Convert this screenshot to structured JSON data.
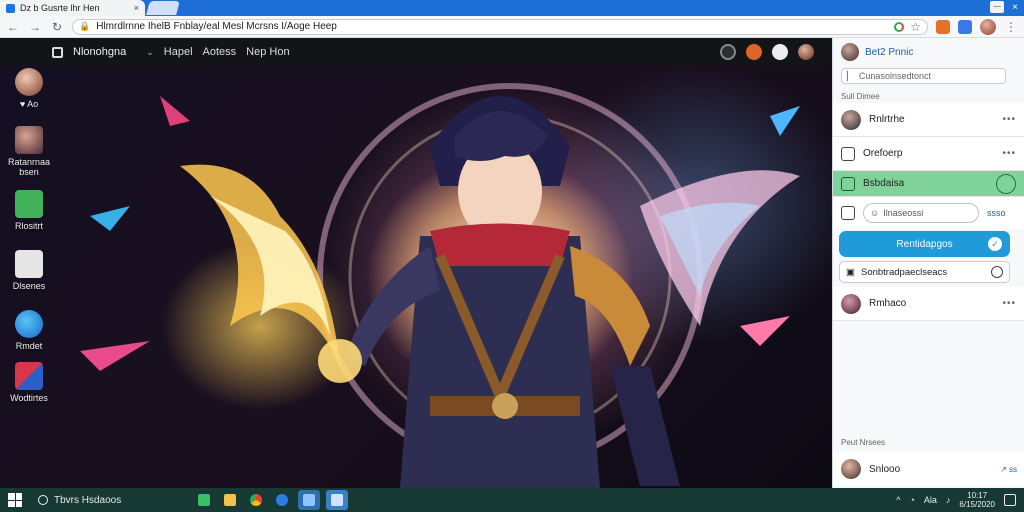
{
  "browser": {
    "tab_title": "Dz b Gusrte lhr Hen",
    "tab_close": "×",
    "url": "Hlmrdlrnne IhelB Fnblay/eal Mesl Mcrsns I/Aoge Heep",
    "window_controls": [
      "—",
      "×"
    ],
    "nav": {
      "back": "←",
      "forward": "→",
      "reload": "↻"
    }
  },
  "appbar": {
    "brand": "Nlonohgna",
    "menu_label": "⌄",
    "nav_items": [
      "Hapel",
      "Aotess",
      "Nep Hon"
    ]
  },
  "desktop_icons": [
    {
      "label": "♥ Ao"
    },
    {
      "label": "Ratanrnaa bsen"
    },
    {
      "label": "Rlositrt"
    },
    {
      "label": "Dlsenes"
    },
    {
      "label": "Rmdet"
    },
    {
      "label": "Wodtirtes"
    }
  ],
  "panel": {
    "header_name": "Bet2 Pnnic",
    "search_placeholder": "Cunasolnsedtonct",
    "section_label": "Sull Dimee",
    "rows": [
      {
        "name": "Rnlrtrhe",
        "more": "•••"
      },
      {
        "name": "Orefoerp",
        "more": "•••"
      }
    ],
    "highlight_row": "Bsbdaisa",
    "input_text": "Ilnaseossi",
    "input_indicator": "ssso",
    "cta_label": "Rentidapgos",
    "select_text": "Sonbtradpaeclseacs",
    "row_after": {
      "name": "Rmhaco",
      "more": "•••"
    },
    "footer_section": "Peut Nrsees",
    "footer_row": {
      "name": "Snlooo",
      "indicator": "↗ ss"
    }
  },
  "taskbar": {
    "search_text": "Tbvrs Hsdaoos",
    "tray_lang": "Ala",
    "clock_time": "10:17",
    "clock_date": "6/15/2020"
  },
  "colors": {
    "accent": "#1a73e8",
    "panel_highlight": "#7fd39a",
    "cta": "#1f9bd9",
    "taskbar": "#163a33"
  }
}
